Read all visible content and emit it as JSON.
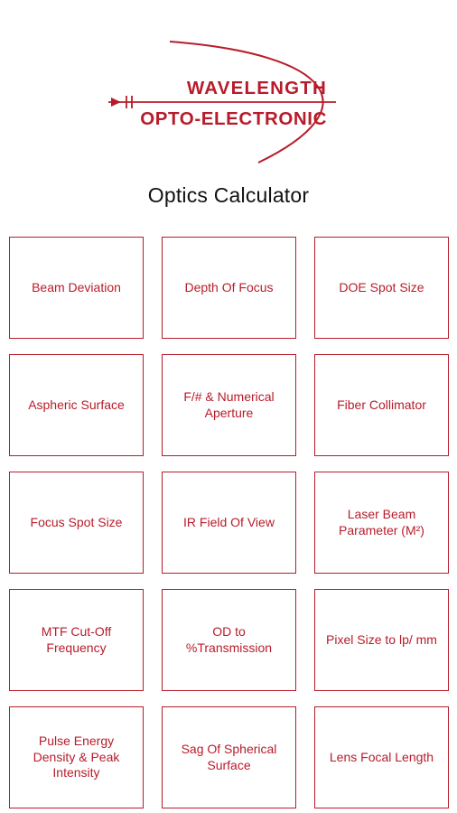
{
  "logo": {
    "line1": "WAVELENGTH",
    "line2": "OPTO-ELECTRONIC",
    "color": "#b71c2a"
  },
  "title": "Optics Calculator",
  "accent_color": "#b71c2a",
  "tiles": [
    {
      "label": "Beam Deviation"
    },
    {
      "label": "Depth Of Focus"
    },
    {
      "label": "DOE Spot Size"
    },
    {
      "label": "Aspheric Surface"
    },
    {
      "label": "F/# & Numerical Aperture"
    },
    {
      "label": "Fiber Collimator"
    },
    {
      "label": "Focus Spot Size"
    },
    {
      "label": "IR Field Of View"
    },
    {
      "label": "Laser Beam Parameter (M²)"
    },
    {
      "label": "MTF Cut-Off Frequency"
    },
    {
      "label": "OD to %Transmission"
    },
    {
      "label": "Pixel Size to lp/ mm"
    },
    {
      "label": "Pulse Energy Density & Peak Intensity"
    },
    {
      "label": "Sag Of Spherical Surface"
    },
    {
      "label": "Lens Focal Length"
    }
  ]
}
